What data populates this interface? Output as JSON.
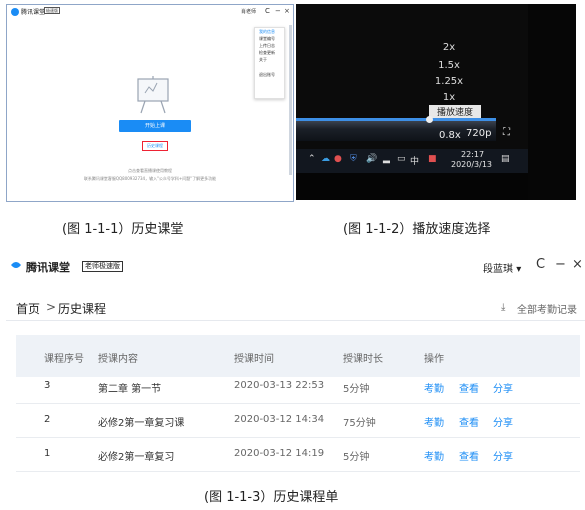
{
  "fig1": {
    "app_name": "腾讯课堂",
    "edition": "极速版",
    "user": "肖老师",
    "controls": [
      "C",
      "−",
      "×"
    ],
    "menu": [
      {
        "label": "我的信息",
        "selected": true
      },
      {
        "label": "课堂编号",
        "selected": false
      },
      {
        "label": "上传日志",
        "selected": false
      },
      {
        "label": "检查更新",
        "selected": false
      },
      {
        "label": "关于",
        "selected": false
      },
      {
        "label": "退出账号",
        "selected": false
      }
    ],
    "start_button": "开始上课",
    "history_button": "历史课程",
    "help_line1": "点击查看直播课使用教程",
    "help_line2": "联系腾讯课堂客服QQ800932734，输入\"公众号学科+问题\"了解更多功能",
    "caption": "(图 1-1-1）历史课堂"
  },
  "fig2": {
    "speeds": [
      "2x",
      "1.5x",
      "1.25x",
      "1x"
    ],
    "selected_label": "播放速度",
    "current_speed": "0.8x",
    "quality": "720p",
    "clock_time": "22:17",
    "clock_date": "2020/3/13",
    "tray_ime": "中",
    "caption": "(图 1-1-2）播放速度选择"
  },
  "fig3": {
    "app_name": "腾讯课堂",
    "edition": "老师极速版",
    "user": "段蓝琪",
    "controls": [
      "C",
      "−",
      "×"
    ],
    "breadcrumb_home": "首页",
    "breadcrumb_sep": ">",
    "breadcrumb_current": "历史课程",
    "download_label": "全部考勤记录",
    "columns": [
      "课程序号",
      "授课内容",
      "授课时间",
      "授课时长",
      "操作"
    ],
    "rows": [
      {
        "no": "3",
        "content": "第二章 第一节",
        "time": "2020-03-13 22:53",
        "duration": "5分钟",
        "ops": [
          "考勤",
          "查看",
          "分享"
        ]
      },
      {
        "no": "2",
        "content": "必修2第一章复习课",
        "time": "2020-03-12 14:34",
        "duration": "75分钟",
        "ops": [
          "考勤",
          "查看",
          "分享"
        ]
      },
      {
        "no": "1",
        "content": "必修2第一章复习",
        "time": "2020-03-12 14:19",
        "duration": "5分钟",
        "ops": [
          "考勤",
          "查看",
          "分享"
        ]
      }
    ],
    "caption": "(图 1-1-3）历史课程单"
  }
}
